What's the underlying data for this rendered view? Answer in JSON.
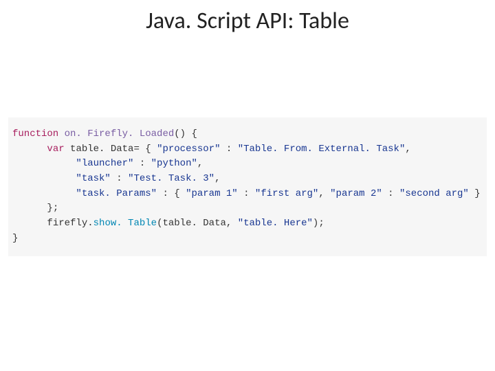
{
  "title": "Java. Script API: Table",
  "code": {
    "kw_function": "function",
    "fn_name": "on. Firefly. Loaded",
    "kw_var": "var",
    "var_tableData": "table. Data",
    "k_processor": "\"processor\"",
    "v_processor": "\"Table. From. External. Task\"",
    "k_launcher": "\"launcher\"",
    "v_launcher": "\"python\"",
    "k_task": "\"task\"",
    "v_task": "\"Test. Task. 3\"",
    "k_taskParams": "\"task. Params\"",
    "k_param1": "\"param 1\"",
    "v_param1": "\"first arg\"",
    "k_param2": "\"param 2\"",
    "v_param2": "\"second arg\"",
    "obj_firefly": "firefly",
    "m_showTable": "show. Table",
    "arg_table": "table. Data",
    "arg_here": "\"table. Here\""
  }
}
